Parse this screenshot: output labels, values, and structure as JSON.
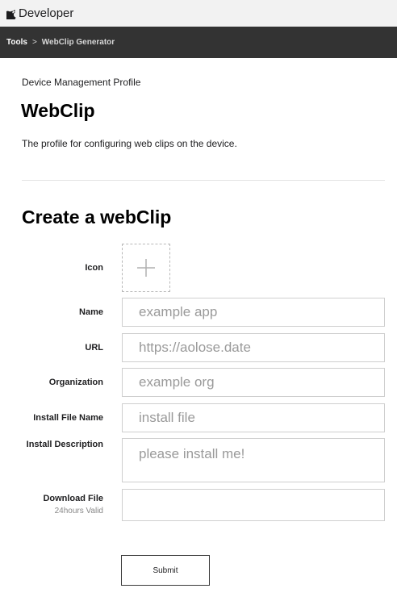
{
  "header": {
    "brand": "Developer",
    "brand_icon": "apple-icon"
  },
  "breadcrumb": {
    "root": "Tools",
    "separator": ">",
    "current": "WebClip Generator"
  },
  "profile": {
    "subtitle": "Device Management Profile",
    "title": "WebClip",
    "description": "The profile for configuring web clips on the device."
  },
  "form": {
    "title": "Create a webClip",
    "icon_label": "Icon",
    "name": {
      "label": "Name",
      "placeholder": "example app"
    },
    "url": {
      "label": "URL",
      "placeholder": "https://aolose.date"
    },
    "organization": {
      "label": "Organization",
      "placeholder": "example org"
    },
    "install_file_name": {
      "label": "Install File Name",
      "placeholder": "install file"
    },
    "install_description": {
      "label": "Install Description",
      "placeholder": "please install me!"
    },
    "download_file": {
      "label": "Download File",
      "sublabel": "24hours Valid"
    },
    "submit_label": "Submit"
  }
}
